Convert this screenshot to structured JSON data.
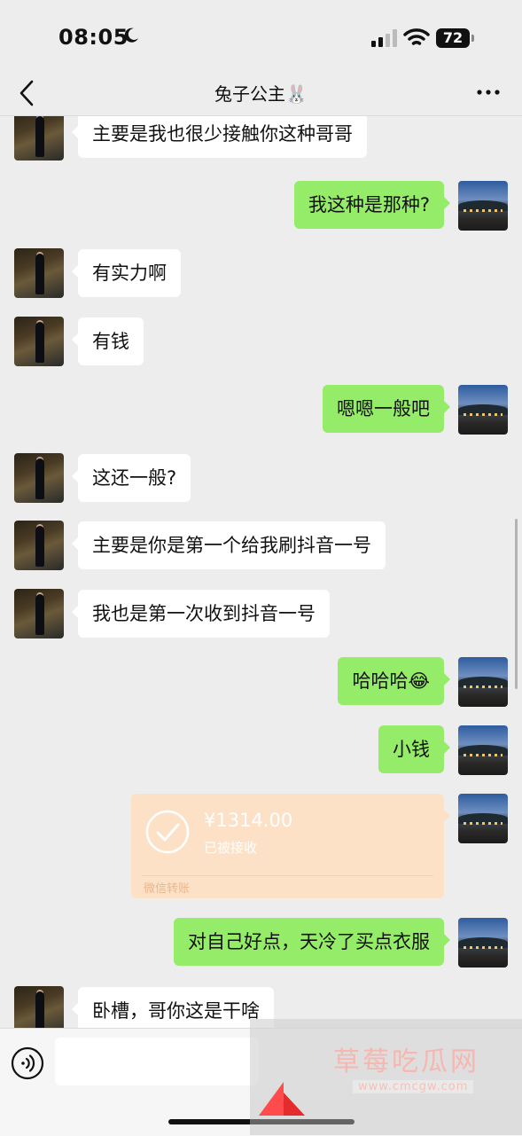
{
  "status_bar": {
    "time": "08:05",
    "battery": "72"
  },
  "header": {
    "title": "兔子公主🐰"
  },
  "messages": [
    {
      "side": "left",
      "text": "主要是我也很少接触你这种哥哥"
    },
    {
      "side": "right",
      "text": "我这种是那种?"
    },
    {
      "side": "left",
      "text": "有实力啊"
    },
    {
      "side": "left",
      "text": "有钱"
    },
    {
      "side": "right",
      "text": "嗯嗯一般吧"
    },
    {
      "side": "left",
      "text": "这还一般?"
    },
    {
      "side": "left",
      "text": "主要是你是第一个给我刷抖音一号"
    },
    {
      "side": "left",
      "text": "我也是第一次收到抖音一号"
    },
    {
      "side": "right",
      "text": "哈哈哈😂"
    },
    {
      "side": "right",
      "text": "小钱"
    },
    {
      "side": "right",
      "text": "对自己好点，天冷了买点衣服"
    },
    {
      "side": "left",
      "text": "卧槽，哥你这是干啥"
    }
  ],
  "transfer": {
    "amount": "¥1314.00",
    "status": "已被接收",
    "footer": "微信转账"
  },
  "watermark": {
    "text": "草莓吃瓜网",
    "url": "www.cmcgw.com"
  },
  "colors": {
    "background": "#ededed",
    "sent_bubble": "#95ec69",
    "received_bubble": "#ffffff",
    "transfer_card": "#fde1c6"
  }
}
